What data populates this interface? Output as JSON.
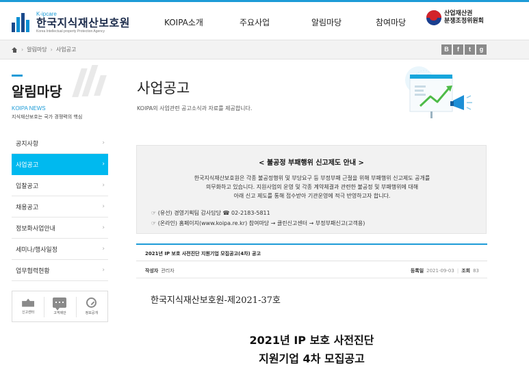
{
  "header": {
    "logo_brand": "K-ipcare",
    "logo_name": "한국지식재산보호원",
    "logo_sub": "Korea Intellectual property Protection Agency",
    "nav": [
      "KOIPA소개",
      "주요사업",
      "알림마당",
      "참여마당"
    ],
    "partner_line1": "산업재산권",
    "partner_line2": "분쟁조정위원회"
  },
  "breadcrumb": {
    "items": [
      "알림마당",
      "사업공고"
    ],
    "share_buttons": [
      "B",
      "f",
      "t",
      "g"
    ]
  },
  "sidebar": {
    "title": "알림마당",
    "subtitle": "KOIPA NEWS",
    "description": "지식재산보호는 국가 경쟁력의 핵심",
    "items": [
      {
        "label": "공지사항",
        "active": false
      },
      {
        "label": "사업공고",
        "active": true
      },
      {
        "label": "입찰공고",
        "active": false
      },
      {
        "label": "채용공고",
        "active": false
      },
      {
        "label": "정보화사업안내",
        "active": false
      },
      {
        "label": "세미나/행사일정",
        "active": false
      },
      {
        "label": "업무협력현황",
        "active": false
      }
    ],
    "quick_links": [
      "신고센터",
      "고객제안",
      "정보공개"
    ]
  },
  "main": {
    "title": "사업공고",
    "description": "KOIPA의 사업관련 공고소식과 자료를 제공합니다.",
    "notice": {
      "title": "< 불공정 부패행위 신고제도 안내 >",
      "body_line1": "한국지식재산보호원은 각종 불공정행위 및 부당요구 등 부정부패 근절을 위해 부패행위 신고제도 공개를",
      "body_line2": "의무화하고 있습니다. 지원사업의 운영 및 각종 계약체결과 관련한 불공정 및 부패행위에 대해",
      "body_line3": "아래 신고 제도를 통해 접수받아 기관운영에 적극 반영하고자 합니다.",
      "contact_phone": "☞ (유선) 경영기획팀 감사담당 ☎ 02-2183-5811",
      "contact_online": "☞ (온라인) 홈페이지(www.koipa.re.kr) 참여마당 → 클린신고센터 → 부정부패신고(고객용)"
    },
    "post": {
      "title": "2021년 IP 보호 사전진단 지원기업 모집공고(4차) 공고",
      "author_label": "작성자",
      "author": "관리자",
      "date_label": "등록일",
      "date": "2021-09-03",
      "views_label": "조회",
      "views": "83"
    },
    "document": {
      "doc_number": "한국지식재산보호원-제2021-37호",
      "heading_line1": "2021년 IP 보호 사전진단",
      "heading_line2": "지원기업 4차 모집공고"
    }
  },
  "colors": {
    "accent": "#00b9ef",
    "brand_blue": "#1d9bd7",
    "brand_navy": "#1a4a8c"
  }
}
